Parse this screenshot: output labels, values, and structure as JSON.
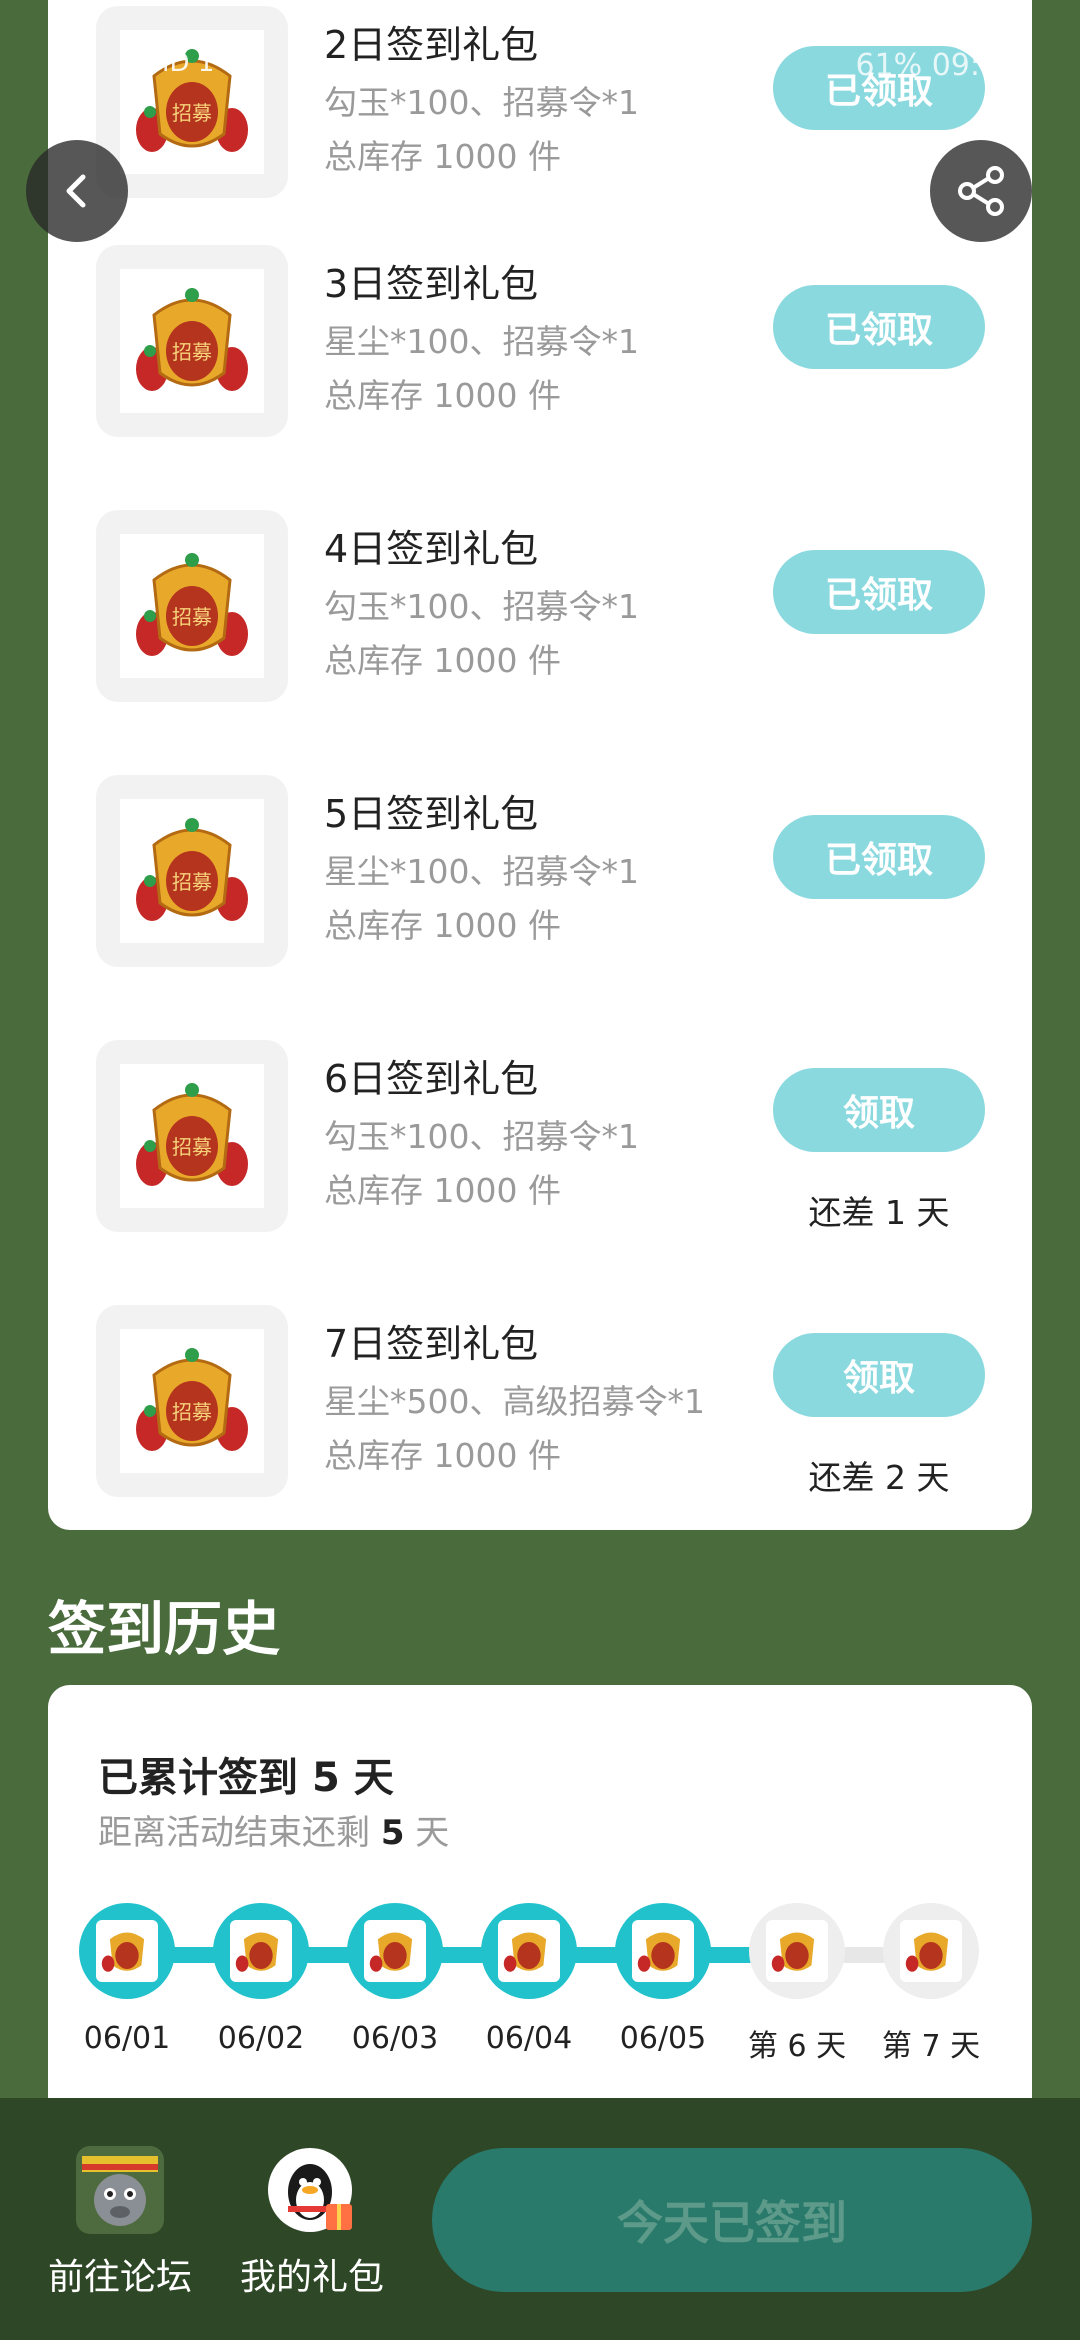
{
  "status": {
    "left": "HD 1  4G",
    "right": "61%  09:"
  },
  "gifts": [
    {
      "title": "2日签到礼包",
      "items": "勾玉*100、招募令*1",
      "stock": "总库存 1000 件",
      "button": "已领取",
      "remaining": ""
    },
    {
      "title": "3日签到礼包",
      "items": "星尘*100、招募令*1",
      "stock": "总库存 1000 件",
      "button": "已领取",
      "remaining": ""
    },
    {
      "title": "4日签到礼包",
      "items": "勾玉*100、招募令*1",
      "stock": "总库存 1000 件",
      "button": "已领取",
      "remaining": ""
    },
    {
      "title": "5日签到礼包",
      "items": "星尘*100、招募令*1",
      "stock": "总库存 1000 件",
      "button": "已领取",
      "remaining": ""
    },
    {
      "title": "6日签到礼包",
      "items": "勾玉*100、招募令*1",
      "stock": "总库存 1000 件",
      "button": "领取",
      "remaining": "还差 1 天"
    },
    {
      "title": "7日签到礼包",
      "items": "星尘*500、高级招募令*1",
      "stock": "总库存 1000 件",
      "button": "领取",
      "remaining": "还差 2 天"
    }
  ],
  "history": {
    "title": "签到历史",
    "total_prefix": "已累计签到 ",
    "total_days": "5",
    "total_suffix": " 天",
    "left_prefix": "距离活动结束还剩 ",
    "left_days": "5",
    "left_suffix": " 天",
    "days": [
      {
        "label": "06/01",
        "done": true
      },
      {
        "label": "06/02",
        "done": true
      },
      {
        "label": "06/03",
        "done": true
      },
      {
        "label": "06/04",
        "done": true
      },
      {
        "label": "06/05",
        "done": true
      },
      {
        "label": "第 6 天",
        "done": false
      },
      {
        "label": "第 7 天",
        "done": false
      }
    ]
  },
  "bottom": {
    "forum_label": "前往论坛",
    "gifts_label": "我的礼包",
    "signed_label": "今天已签到"
  },
  "seal_char": "招募",
  "colors": {
    "bg": "#4a6b3c",
    "accent": "#21c2cc",
    "button": "#8ad9df",
    "bottom_bar": "#2e4726",
    "signed_btn": "#2a7a6c"
  }
}
